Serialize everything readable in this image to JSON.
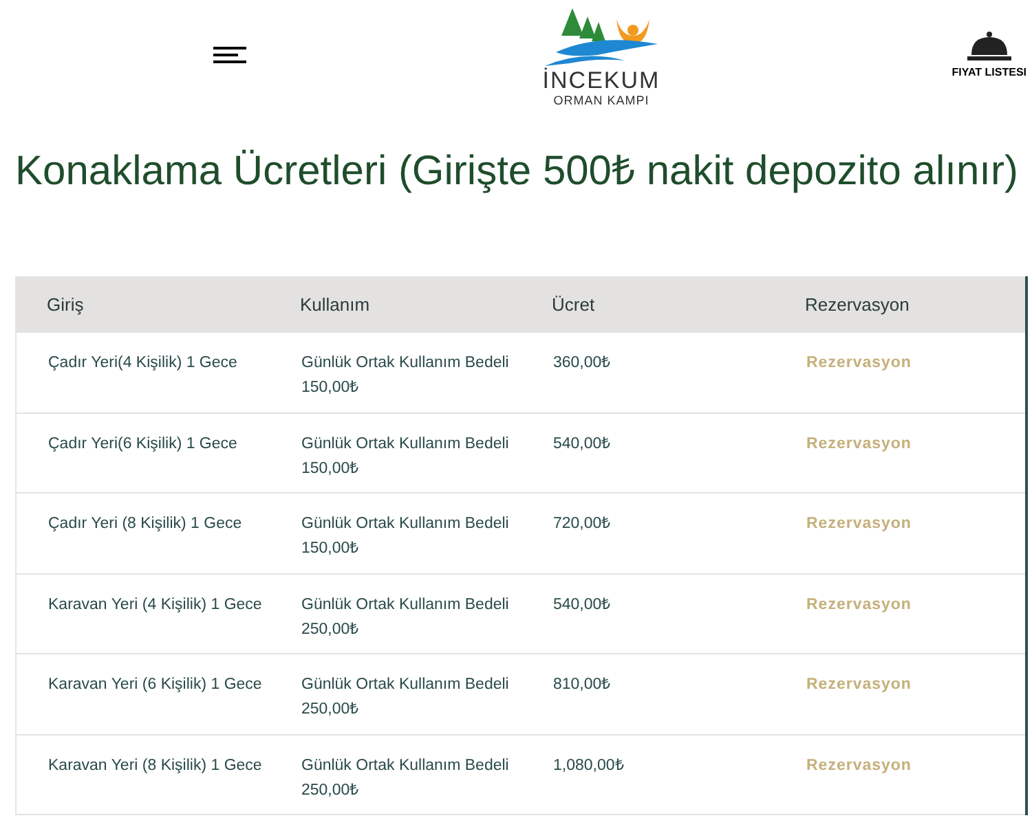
{
  "header": {
    "logo": {
      "name": "İNCEKUM",
      "subtitle": "ORMAN KAMPI"
    },
    "price_list_label": "FIYAT LISTESI"
  },
  "title": "Konaklama Ücretleri (Girişte 500₺ nakit depozito alınır)",
  "table": {
    "columns": [
      "Giriş",
      "Kullanım",
      "Ücret",
      "Rezervasyon"
    ],
    "rows": [
      {
        "entry": "Çadır Yeri(4 Kişilik) 1 Gece",
        "usage": "Günlük Ortak Kullanım Bedeli 150,00₺",
        "price": "360,00₺",
        "action": "Rezervasyon"
      },
      {
        "entry": "Çadır Yeri(6 Kişilik) 1 Gece",
        "usage": "Günlük Ortak Kullanım Bedeli 150,00₺",
        "price": "540,00₺",
        "action": "Rezervasyon"
      },
      {
        "entry": "Çadır Yeri (8 Kişilik) 1 Gece",
        "usage": "Günlük Ortak Kullanım Bedeli 150,00₺",
        "price": "720,00₺",
        "action": "Rezervasyon"
      },
      {
        "entry": "Karavan Yeri (4 Kişilik) 1 Gece",
        "usage": "Günlük Ortak Kullanım Bedeli 250,00₺",
        "price": "540,00₺",
        "action": "Rezervasyon"
      },
      {
        "entry": "Karavan Yeri (6 Kişilik) 1 Gece",
        "usage": "Günlük Ortak Kullanım Bedeli 250,00₺",
        "price": "810,00₺",
        "action": "Rezervasyon"
      },
      {
        "entry": "Karavan Yeri (8 Kişilik) 1 Gece",
        "usage": "Günlük Ortak Kullanım Bedeli 250,00₺",
        "price": "1,080,00₺",
        "action": "Rezervasyon"
      }
    ]
  }
}
